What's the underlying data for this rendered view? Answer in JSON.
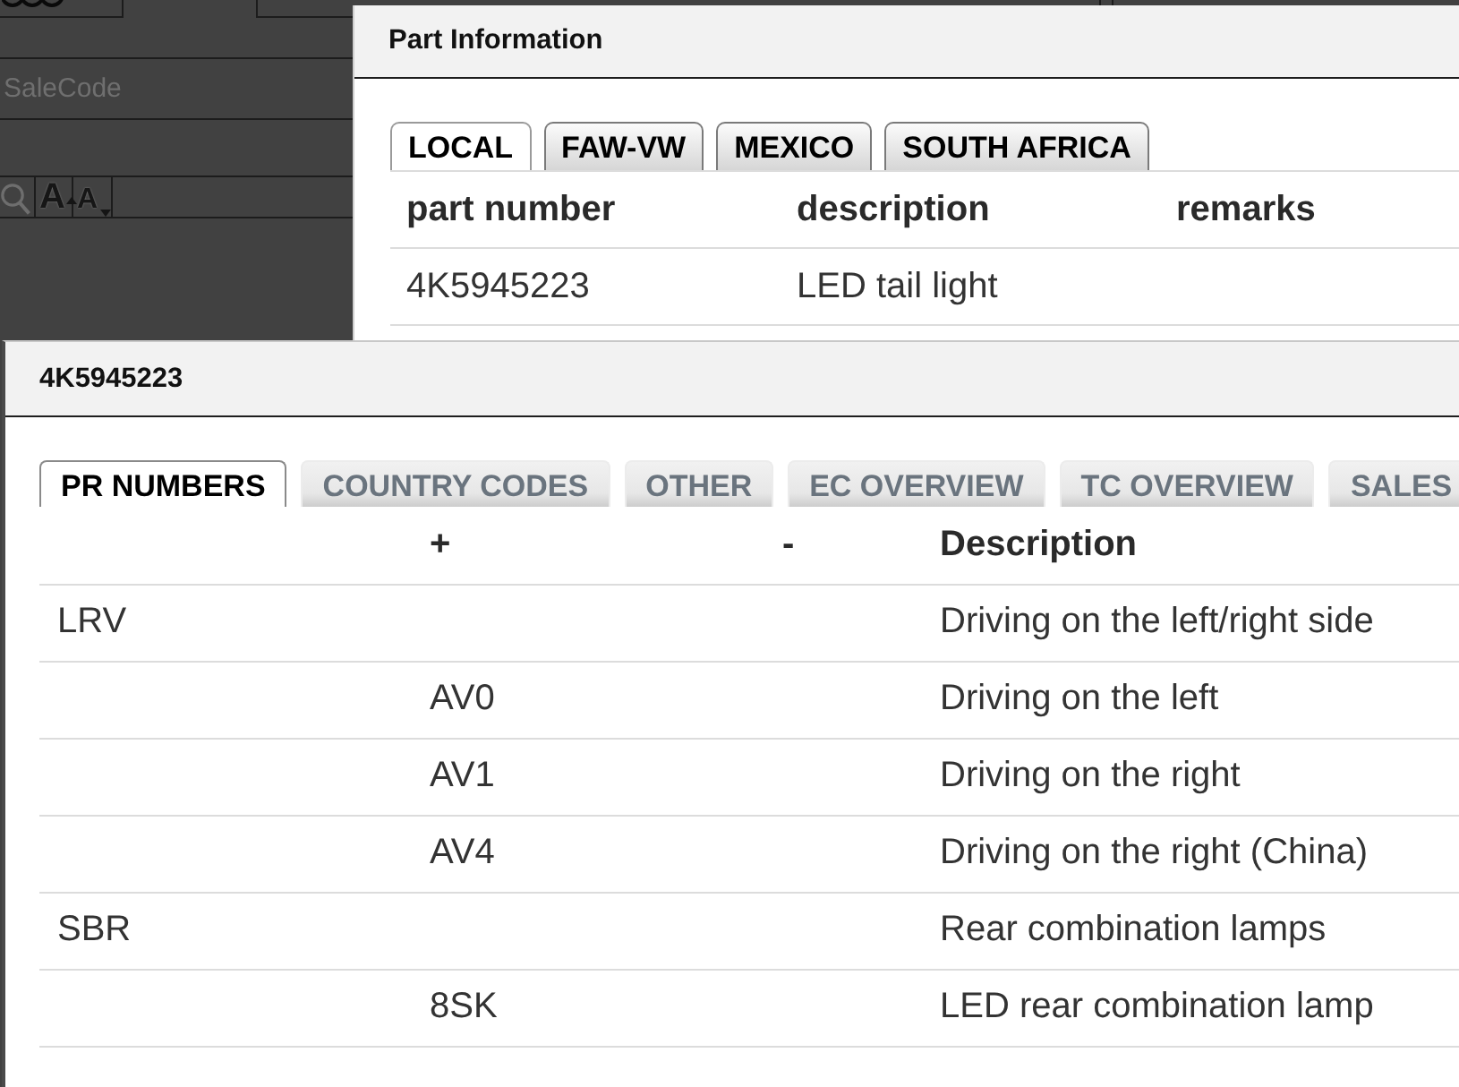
{
  "form": {
    "sale_code_field": {
      "placeholder": "SaleCode"
    },
    "font_buttons": [
      {
        "label": "A",
        "kind": "increase"
      },
      {
        "label": "A",
        "kind": "decrease"
      }
    ]
  },
  "part_dialog": {
    "title": "Part Information",
    "tabs": [
      {
        "label": "LOCAL",
        "selected": true
      },
      {
        "label": "FAW-VW",
        "selected": false
      },
      {
        "label": "MEXICO",
        "selected": false
      },
      {
        "label": "SOUTH AFRICA",
        "selected": false
      }
    ],
    "table": {
      "headers": {
        "part_number": "part number",
        "description": "description",
        "remarks": "remarks"
      },
      "rows": [
        {
          "part_number": "4K5945223",
          "description": "LED tail light"
        }
      ]
    }
  },
  "pr_dialog": {
    "title": "4K5945223",
    "tabs": [
      {
        "label": "PR NUMBERS",
        "selected": true
      },
      {
        "label": "COUNTRY CODES",
        "selected": false
      },
      {
        "label": "OTHER",
        "selected": false
      },
      {
        "label": "EC OVERVIEW",
        "selected": false
      },
      {
        "label": "TC OVERVIEW",
        "selected": false
      },
      {
        "label": "SALES",
        "selected": false
      }
    ],
    "table": {
      "headers": {
        "plus": "+",
        "minus": "-",
        "description": "Description"
      },
      "rows": [
        {
          "column_1": "LRV",
          "description": "Driving on the left/right side"
        },
        {
          "plus": "AV0",
          "description": "Driving on the left"
        },
        {
          "plus": "AV1",
          "description": "Driving on the right"
        },
        {
          "plus": "AV4",
          "description": "Driving on the right (China)"
        },
        {
          "column_1": "SBR",
          "description": "Rear combination lamps"
        },
        {
          "plus": "8SK",
          "description": "LED rear combination lamp"
        }
      ]
    }
  }
}
